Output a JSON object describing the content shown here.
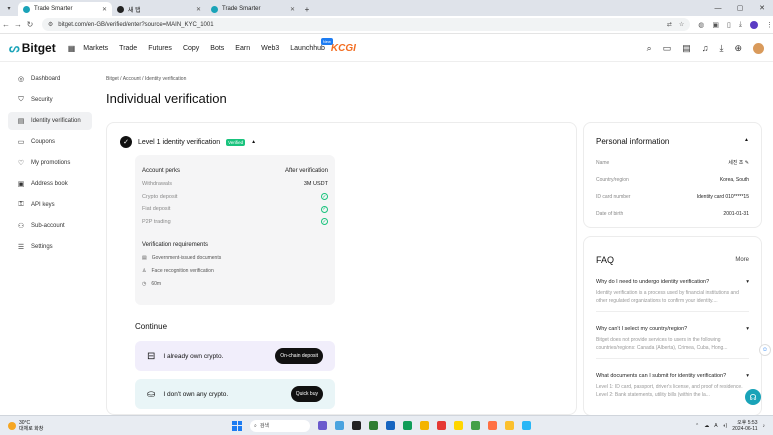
{
  "browser": {
    "tabs": [
      {
        "title": "Trade Smarter",
        "active": true
      },
      {
        "title": "새 탭",
        "active": false
      },
      {
        "title": "Trade Smarter",
        "active": false
      }
    ],
    "url": "bitget.com/en-GB/verified/enter?source=MAIN_KYC_1001"
  },
  "header": {
    "logo": "Bitget",
    "menu": [
      "Markets",
      "Trade",
      "Futures",
      "Copy",
      "Bots",
      "Earn",
      "Web3",
      "Launchhub"
    ],
    "new_badge": "New",
    "promo": "KCGI"
  },
  "sidebar": {
    "items": [
      {
        "label": "Dashboard",
        "icon": "dashboard-icon",
        "glyph": "◎"
      },
      {
        "label": "Security",
        "icon": "shield-icon",
        "glyph": "⛉"
      },
      {
        "label": "Identity verification",
        "icon": "id-card-icon",
        "glyph": "▤"
      },
      {
        "label": "Coupons",
        "icon": "coupon-icon",
        "glyph": "▭"
      },
      {
        "label": "My promotions",
        "icon": "promotion-icon",
        "glyph": "♡"
      },
      {
        "label": "Address book",
        "icon": "address-book-icon",
        "glyph": "▣"
      },
      {
        "label": "API keys",
        "icon": "api-key-icon",
        "glyph": "⚿"
      },
      {
        "label": "Sub-account",
        "icon": "sub-account-icon",
        "glyph": "⚇"
      },
      {
        "label": "Settings",
        "icon": "settings-icon",
        "glyph": "☰"
      }
    ]
  },
  "page": {
    "breadcrumb": [
      "Bitget",
      "Account",
      "Identity verification"
    ],
    "title": "Individual verification"
  },
  "level": {
    "title": "Level 1 identity verification",
    "badge": "Verified",
    "perks_header": "Account perks",
    "after_header": "After verification",
    "perks": [
      {
        "label": "Withdrawals",
        "value": "3M USDT"
      },
      {
        "label": "Crypto deposit",
        "value": "✓"
      },
      {
        "label": "Fiat deposit",
        "value": "✓"
      },
      {
        "label": "P2P trading",
        "value": "✓"
      }
    ],
    "requirements_title": "Verification requirements",
    "requirements": [
      {
        "label": "Government-issued documents",
        "glyph": "▤"
      },
      {
        "label": "Face recognition verification",
        "glyph": "♙"
      },
      {
        "label": "60m",
        "glyph": "◷"
      }
    ]
  },
  "continue": {
    "title": "Continue",
    "options": [
      {
        "label": "I already own crypto.",
        "button": "On-chain deposit"
      },
      {
        "label": "I don't own any crypto.",
        "button": "Quick buy"
      }
    ]
  },
  "personal": {
    "title": "Personal information",
    "rows": [
      {
        "label": "Name",
        "value": "세진 조 ✎"
      },
      {
        "label": "Country/region",
        "value": "Korea, South"
      },
      {
        "label": "ID card number",
        "value": "Identity card 010*****15"
      },
      {
        "label": "Date of birth",
        "value": "2001-01-31"
      }
    ]
  },
  "faq": {
    "title": "FAQ",
    "more": "More",
    "items": [
      {
        "q": "Why do I need to undergo identity verification?",
        "a": "Identity verification is a process used by financial institutions and other regulated organizations to confirm your identity...."
      },
      {
        "q": "Why can't I select my country/region?",
        "a": "Bitget does not provide services to users in the following countries/regions: Canada (Alberta), Crimea, Cuba, Hong..."
      },
      {
        "q": "What documents can I submit for identity verification?",
        "a": "Level 1: ID card, passport, driver's license, and proof of residence. Level 2: Bank statements, utility bills (within the la..."
      }
    ]
  },
  "taskbar": {
    "weather_temp": "30°C",
    "weather_desc": "대체로 화창",
    "search": "검색",
    "time": "오후 5:53",
    "date": "2024-06-11"
  }
}
